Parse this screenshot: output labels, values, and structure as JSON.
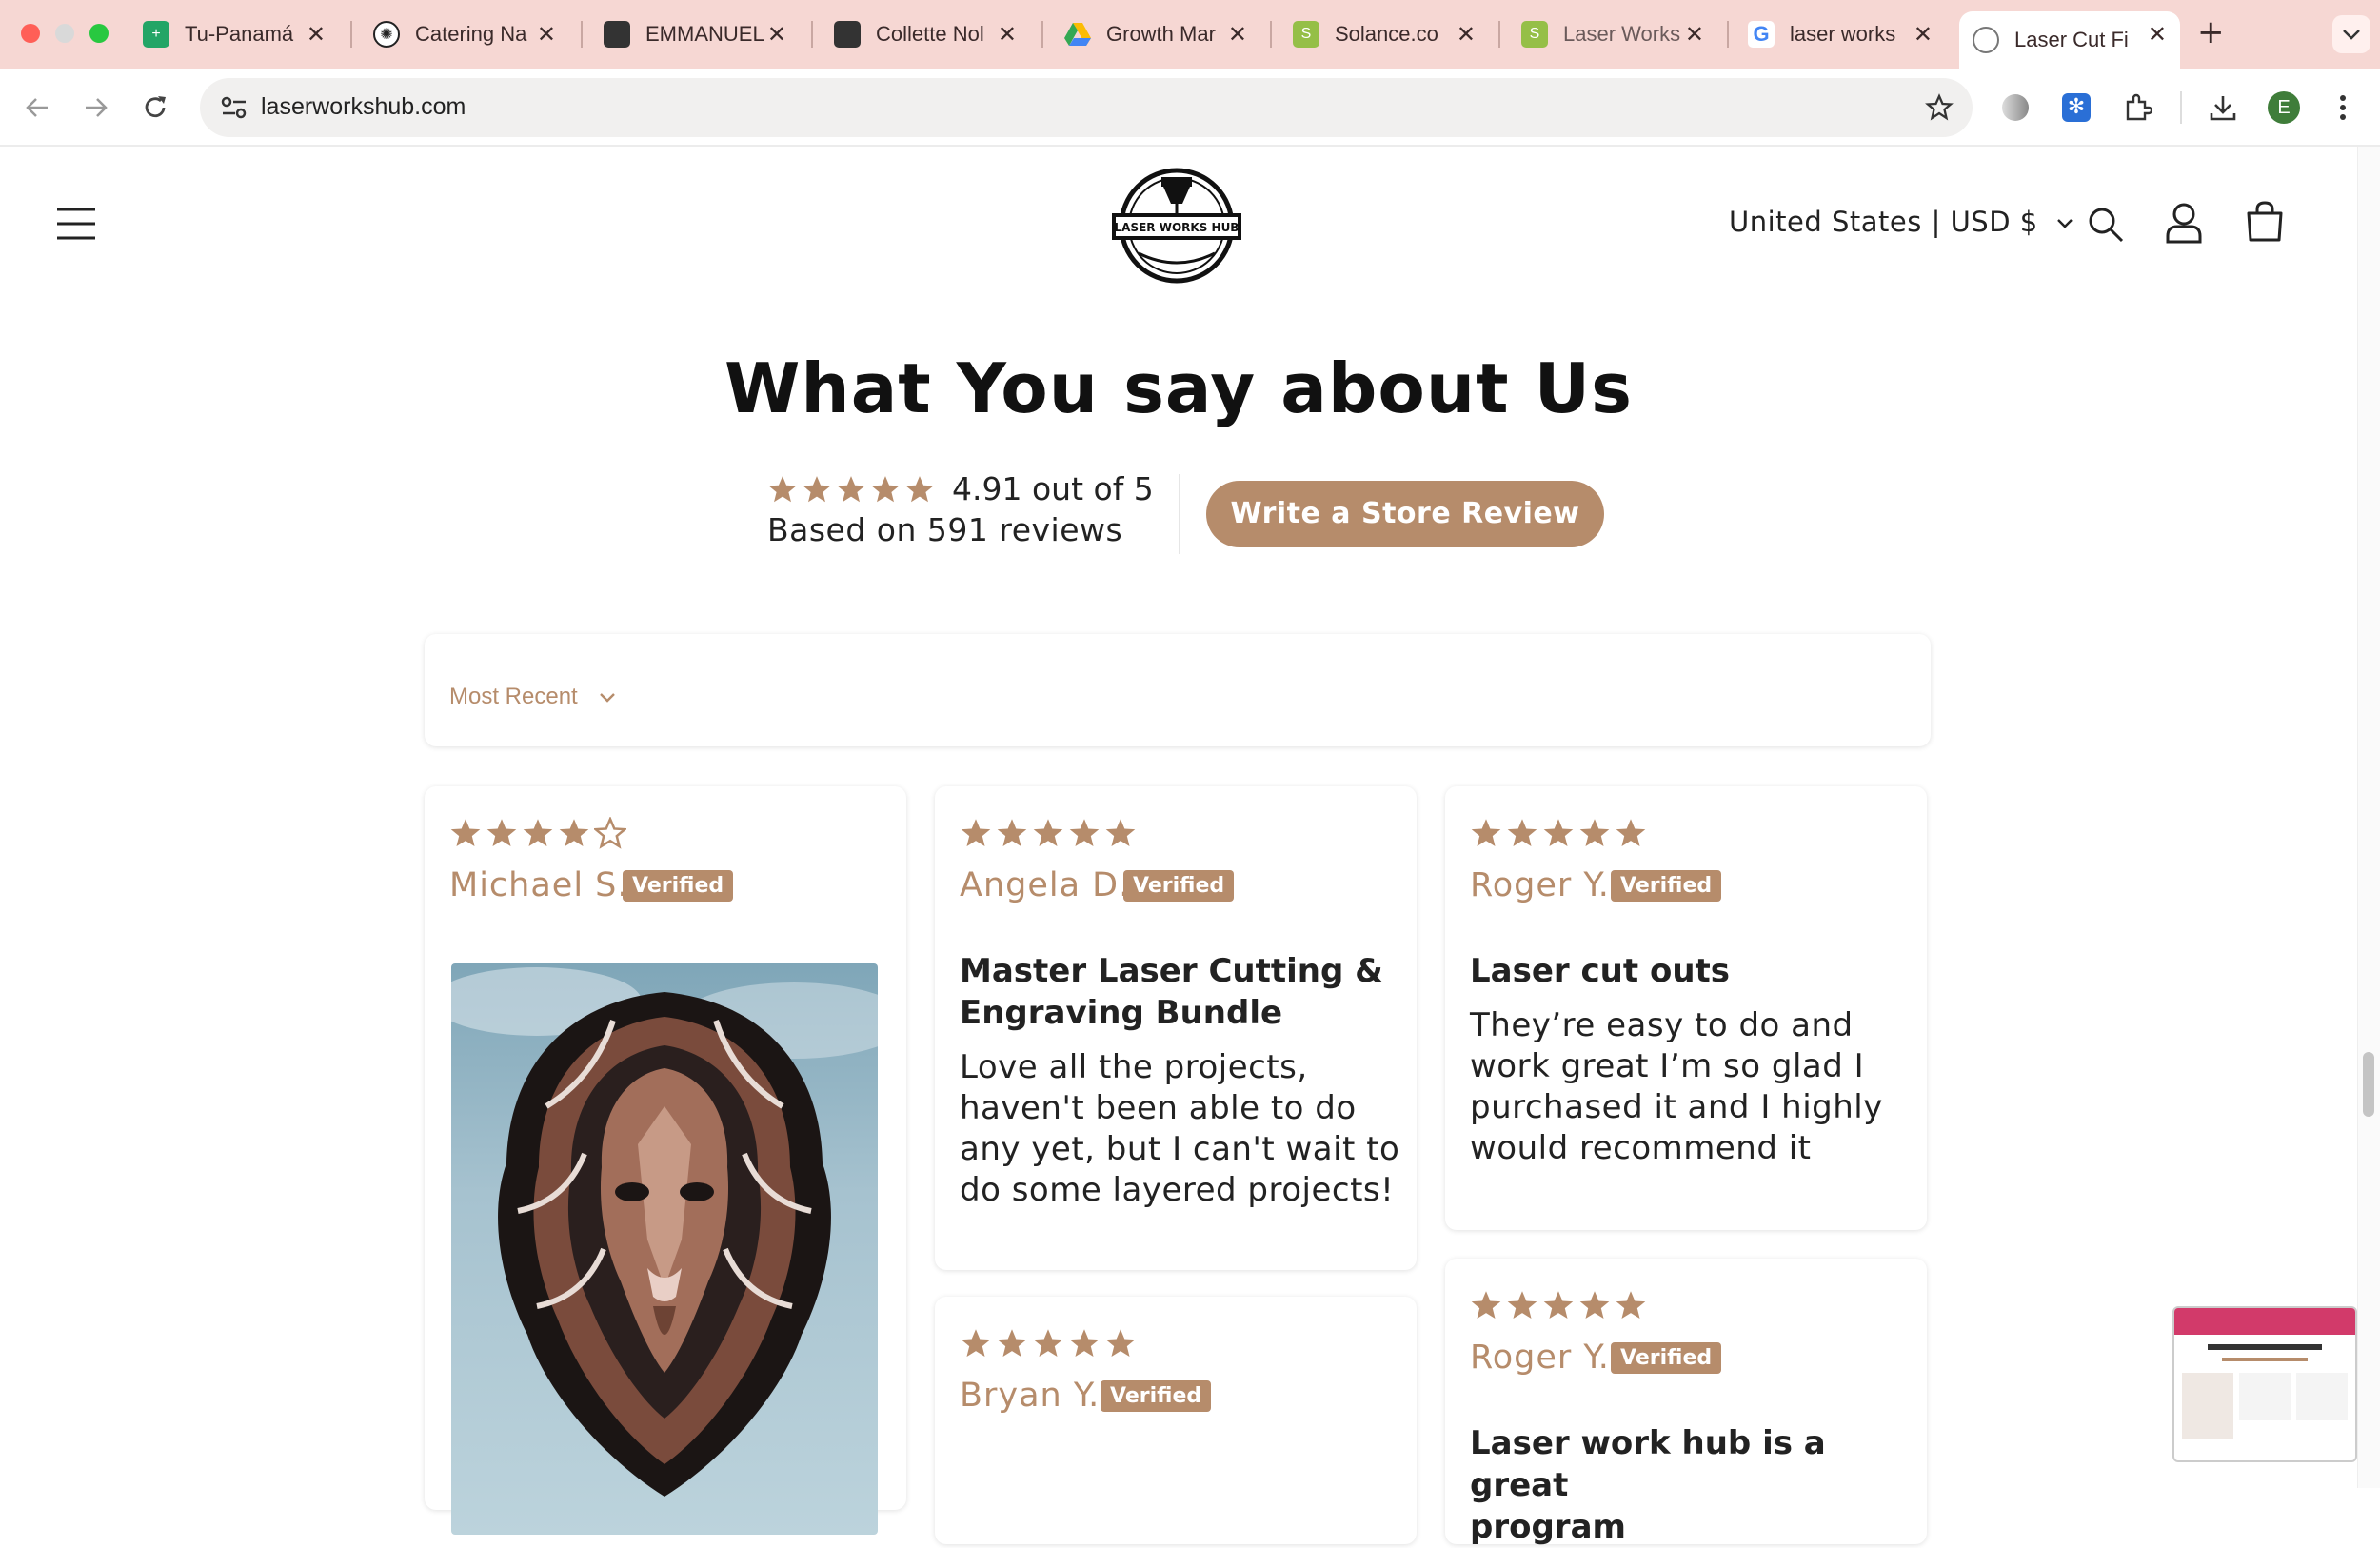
{
  "browser": {
    "tabs": [
      {
        "title": "Tu-Panamá",
        "favicon": "sheets-icon",
        "color": "#23a566"
      },
      {
        "title": "Catering Na",
        "favicon": "openai-icon",
        "color": "#222222"
      },
      {
        "title": "EMMANUEL",
        "favicon": "cube-icon",
        "color": "#333333"
      },
      {
        "title": "Collette Nol",
        "favicon": "cube-icon",
        "color": "#333333"
      },
      {
        "title": "Growth Mar",
        "favicon": "drive-icon",
        "color": "#4285f4"
      },
      {
        "title": "Solance.co",
        "favicon": "shopify-icon",
        "color": "#95bf47"
      },
      {
        "title": "Laser Works",
        "favicon": "shopify-icon",
        "color": "#95bf47"
      },
      {
        "title": "laser works",
        "favicon": "google-icon",
        "color": "#4285f4"
      },
      {
        "title": "Laser Cut Fi",
        "favicon": "globe-icon",
        "color": "#555555",
        "active": true
      }
    ],
    "url": "laserworkshub.com",
    "profile_initial": "E"
  },
  "site": {
    "logo_text": "LASER WORKS HUB",
    "currency_label": "United States | USD $"
  },
  "reviews_section": {
    "heading": "What You say about Us",
    "average": "4.91 out of 5",
    "based_on": "Based on 591 reviews",
    "average_stars": 5,
    "write_review_label": "Write a Store Review",
    "sort_label": "Most Recent"
  },
  "reviews": [
    {
      "name": "Michael S.",
      "verified": "Verified",
      "stars": 4,
      "title": "",
      "body": "",
      "image": "layered lion head wood art"
    },
    {
      "name": "Angela D.",
      "verified": "Verified",
      "stars": 5,
      "title_lines": [
        "Master Laser Cutting &",
        "Engraving Bundle"
      ],
      "body_lines": [
        "Love all the projects,",
        "haven't been able to do",
        "any yet, but I can't wait to",
        "do some layered projects!"
      ]
    },
    {
      "name": "Roger Y.",
      "verified": "Verified",
      "stars": 5,
      "title_lines": [
        "Laser cut outs"
      ],
      "body_lines": [
        "They’re easy to do and",
        "work great I’m so glad I",
        "purchased it and I highly",
        "would recommend it"
      ]
    },
    {
      "name": "Bryan Y.",
      "verified": "Verified",
      "stars": 5
    },
    {
      "name": "Roger Y.",
      "verified": "Verified",
      "stars": 5,
      "title_lines": [
        "Laser work hub is a great",
        "program"
      ]
    }
  ],
  "colors": {
    "accent": "#b68c6b",
    "tabbar": "#f6d7d3"
  }
}
